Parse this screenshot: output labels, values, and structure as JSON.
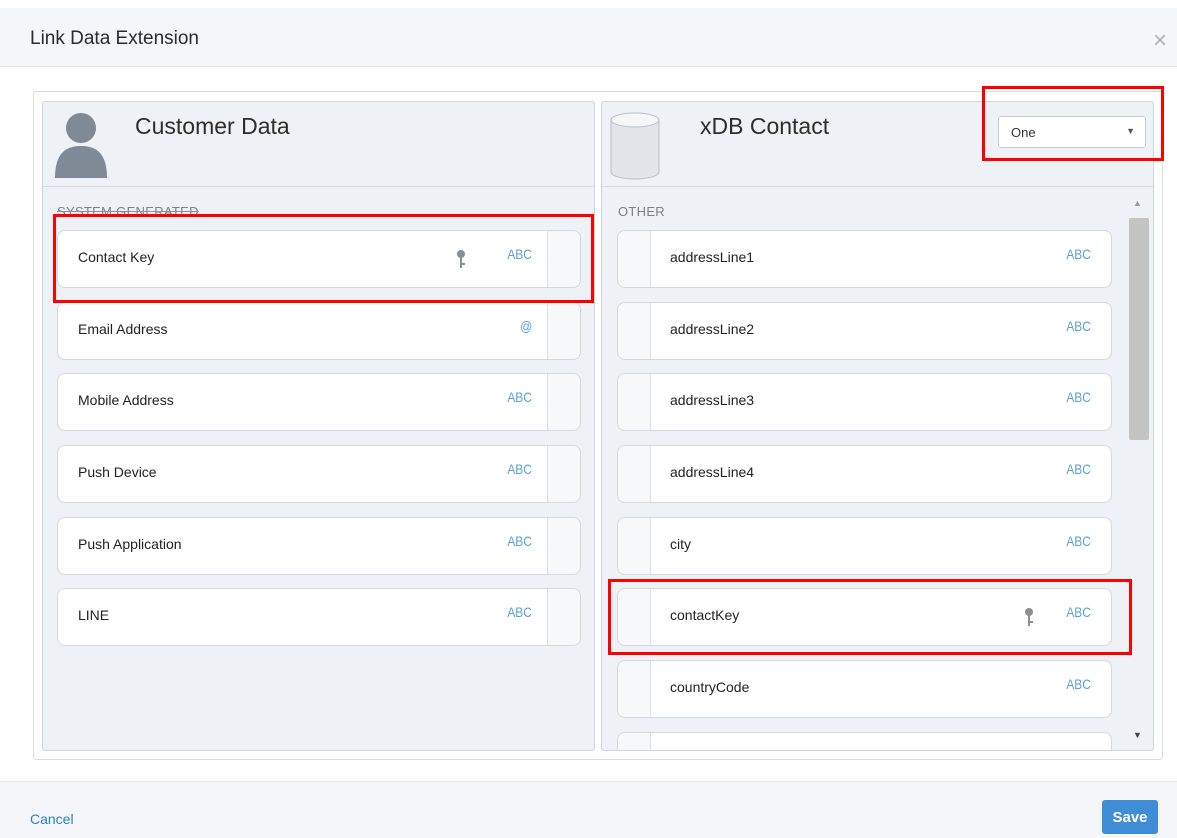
{
  "header": {
    "title": "Link Data Extension",
    "close_glyph": "×"
  },
  "left": {
    "title": "Customer Data",
    "section": "SYSTEM GENERATED",
    "fields": [
      {
        "name": "Contact Key",
        "type": "ABC",
        "key": true
      },
      {
        "name": "Email Address",
        "type": "@",
        "key": false
      },
      {
        "name": "Mobile Address",
        "type": "ABC",
        "key": false
      },
      {
        "name": "Push Device",
        "type": "ABC",
        "key": false
      },
      {
        "name": "Push Application",
        "type": "ABC",
        "key": false
      },
      {
        "name": "LINE",
        "type": "ABC",
        "key": false
      }
    ]
  },
  "right": {
    "title": "xDB Contact",
    "relationship": "One",
    "section": "OTHER",
    "fields": [
      {
        "name": "addressLine1",
        "type": "ABC",
        "key": false
      },
      {
        "name": "addressLine2",
        "type": "ABC",
        "key": false
      },
      {
        "name": "addressLine3",
        "type": "ABC",
        "key": false
      },
      {
        "name": "addressLine4",
        "type": "ABC",
        "key": false
      },
      {
        "name": "city",
        "type": "ABC",
        "key": false
      },
      {
        "name": "contactKey",
        "type": "ABC",
        "key": true
      },
      {
        "name": "countryCode",
        "type": "ABC",
        "key": false
      }
    ]
  },
  "footer": {
    "cancel": "Cancel",
    "save": "Save"
  },
  "colors": {
    "accent": "#3e8dd6",
    "type_text": "#5aa0d2",
    "highlight": "#ff0000"
  },
  "icons": [
    "close-icon",
    "person-icon",
    "database-icon",
    "key-icon",
    "chevron-down-icon",
    "scroll-up-icon",
    "scroll-down-icon"
  ]
}
